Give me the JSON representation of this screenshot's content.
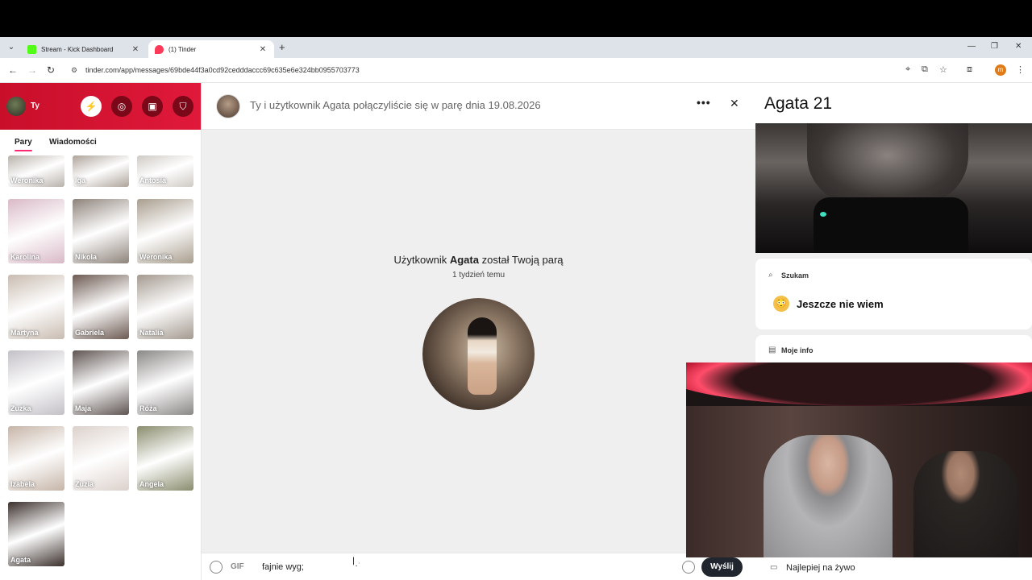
{
  "browser": {
    "tabs": [
      {
        "title": "Stream - Kick Dashboard",
        "favicon_color": "#53fc18",
        "active": false
      },
      {
        "title": "(1) Tinder",
        "favicon_color": "#fd3a5a",
        "active": true
      }
    ],
    "new_tab_icon": "plus-icon",
    "url": "tinder.com/app/messages/69bde44f3a0cd92cedddaccc69c635e6e324bb0955703773",
    "profile_initial": "m"
  },
  "sidebar": {
    "user_label": "Ty",
    "tabs": [
      "Pary",
      "Wiadomości"
    ],
    "selected_tab": "Pary",
    "matches": [
      {
        "name": "Weronika",
        "tone": "#b9b2ab"
      },
      {
        "name": "Iga",
        "tone": "#aea49b"
      },
      {
        "name": "Antosia",
        "tone": "#cfcac4"
      },
      {
        "name": "Karolina",
        "tone": "#d9b9c6"
      },
      {
        "name": "Nikola",
        "tone": "#8e837b"
      },
      {
        "name": "Weronika",
        "tone": "#a99e8f"
      },
      {
        "name": "Martyna",
        "tone": "#c9bcb1"
      },
      {
        "name": "Gabriela",
        "tone": "#6d5a52"
      },
      {
        "name": "Natalia",
        "tone": "#a49a90"
      },
      {
        "name": "Zuzka",
        "tone": "#c3c0c6"
      },
      {
        "name": "Maja",
        "tone": "#5f5552"
      },
      {
        "name": "Róża",
        "tone": "#8a8886"
      },
      {
        "name": "Izabela",
        "tone": "#c6b5a8"
      },
      {
        "name": "Zuzia",
        "tone": "#dcd1cb"
      },
      {
        "name": "Angela",
        "tone": "#8a8d6e"
      },
      {
        "name": "Agata",
        "tone": "#3b302c"
      }
    ]
  },
  "chat": {
    "header_title": "Ty i użytkownik Agata połączyliście się w parę dnia 19.08.2026",
    "match_note_prefix": "Użytkownik",
    "match_note_name": "Agata",
    "match_note_suffix": "został Twoją parą",
    "match_ago": "1 tydzień temu",
    "composer": {
      "gif_label": "GIF",
      "input_value": "fajnie wyg;",
      "send_label": "Wyślij"
    }
  },
  "profile": {
    "name_age": "Agata 21",
    "looking_for_label": "Szukam",
    "looking_for_value": "Jeszcze nie wiem",
    "looking_for_emoji": "😳",
    "about_label": "Moje info",
    "live_label": "Najlepiej na żywo"
  }
}
